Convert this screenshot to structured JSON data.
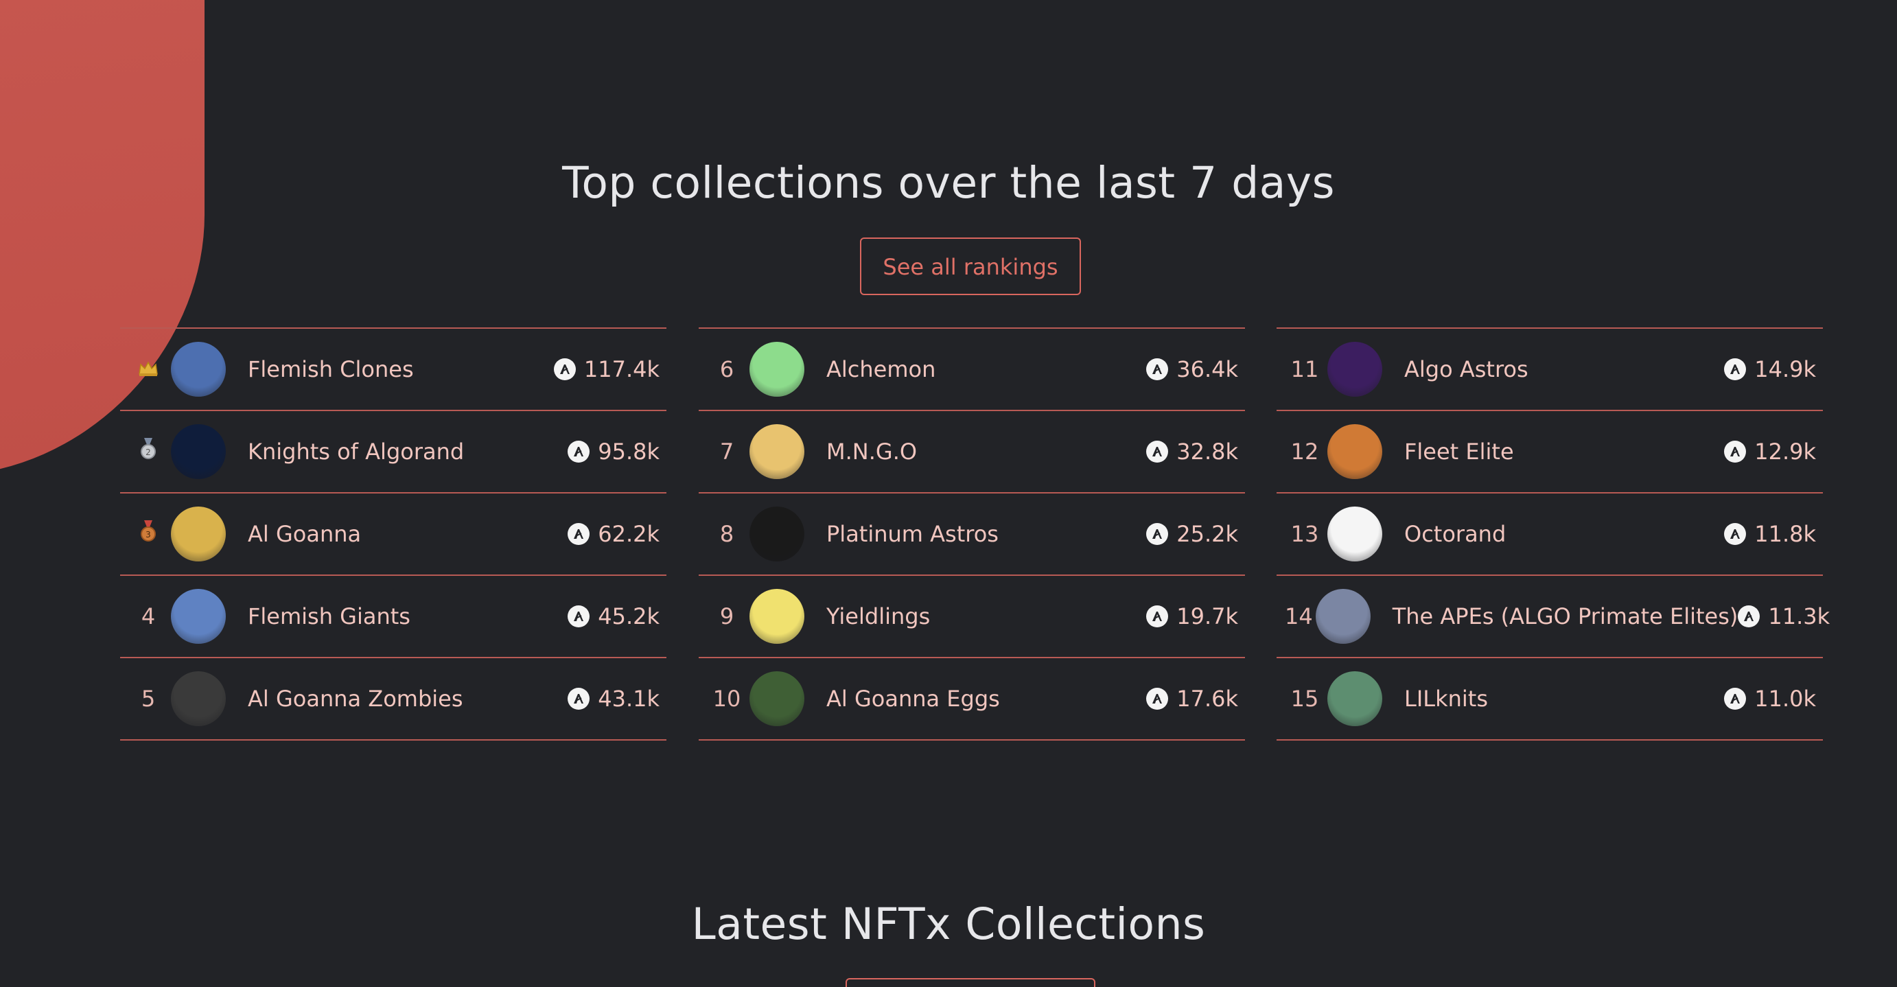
{
  "top_section": {
    "title": "Top collections over the last 7 days",
    "see_all_label": "See all rankings"
  },
  "latest_section": {
    "title": "Latest NFTx Collections"
  },
  "rankings": {
    "col1": [
      {
        "rank": "",
        "badge": "crown",
        "name": "Flemish Clones",
        "volume": "117.4k",
        "avatar_color": "#4d6fb0"
      },
      {
        "rank": "",
        "badge": "silver-medal",
        "name": "Knights of Algorand",
        "volume": "95.8k",
        "avatar_color": "#0f1d3b"
      },
      {
        "rank": "",
        "badge": "bronze-medal",
        "name": "Al Goanna",
        "volume": "62.2k",
        "avatar_color": "#d9b24c"
      },
      {
        "rank": "4",
        "badge": "",
        "name": "Flemish Giants",
        "volume": "45.2k",
        "avatar_color": "#5f82c2"
      },
      {
        "rank": "5",
        "badge": "",
        "name": "Al Goanna Zombies",
        "volume": "43.1k",
        "avatar_color": "#3a3a3a"
      }
    ],
    "col2": [
      {
        "rank": "6",
        "name": "Alchemon",
        "volume": "36.4k",
        "avatar_color": "#8ddc8c"
      },
      {
        "rank": "7",
        "name": "M.N.G.O",
        "volume": "32.8k",
        "avatar_color": "#e8c36f"
      },
      {
        "rank": "8",
        "name": "Platinum Astros",
        "volume": "25.2k",
        "avatar_color": "#1a1a1a"
      },
      {
        "rank": "9",
        "name": "Yieldlings",
        "volume": "19.7k",
        "avatar_color": "#f0e16f"
      },
      {
        "rank": "10",
        "name": "Al Goanna Eggs",
        "volume": "17.6k",
        "avatar_color": "#3f5f35"
      }
    ],
    "col3": [
      {
        "rank": "11",
        "name": "Algo Astros",
        "volume": "14.9k",
        "avatar_color": "#3c1e60"
      },
      {
        "rank": "12",
        "name": "Fleet Elite",
        "volume": "12.9k",
        "avatar_color": "#d07a35"
      },
      {
        "rank": "13",
        "name": "Octorand",
        "volume": "11.8k",
        "avatar_color": "#f5f5f5"
      },
      {
        "rank": "14",
        "name": "The APEs (ALGO Primate Elites)",
        "volume": "11.3k",
        "avatar_color": "#7b86a3"
      },
      {
        "rank": "15",
        "name": "LILknits",
        "volume": "11.0k",
        "avatar_color": "#5d8e70"
      }
    ]
  },
  "icons": {
    "currency": "algorand-icon",
    "first": "crown-icon",
    "second": "silver-medal-icon",
    "third": "bronze-medal-icon"
  },
  "colors": {
    "background": "#222327",
    "accent": "#d9665e",
    "divider": "#b85a54",
    "text": "#f1c6bf"
  }
}
